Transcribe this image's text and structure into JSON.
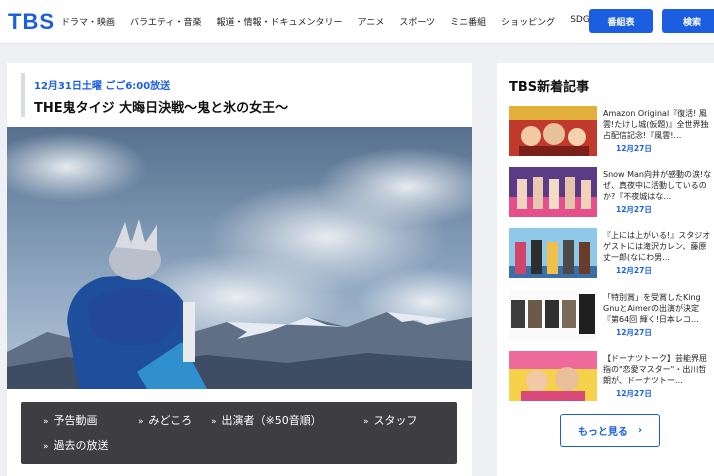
{
  "header": {
    "logo": "TBS",
    "nav": [
      "ドラマ・映画",
      "バラエティ・音楽",
      "報道・情報・ドキュメンタリー",
      "アニメ",
      "スポーツ",
      "ミニ番組",
      "ショッピング",
      "SDGs"
    ],
    "bangumi_label": "番組表",
    "search_label": "検索"
  },
  "program": {
    "date": "12月31日土曜 ごご6:00放送",
    "title": "THE鬼タイジ 大晦日決戦〜鬼と氷の女王〜"
  },
  "program_menu": {
    "items": [
      "予告動画",
      "みどころ",
      "出演者（※50音順）",
      "スタッフ",
      "過去の放送"
    ]
  },
  "sidebar": {
    "title": "TBS新着記事",
    "articles": [
      {
        "text": "Amazon Original『復活! 風雲!たけし城(仮題)』全世界独占配信記念!『風雲!…",
        "date": "12月27日"
      },
      {
        "text": "Snow Man向井が感動の涙!なぜ、真夜中に活動しているのか?『不夜城はな…",
        "date": "12月27日"
      },
      {
        "text": "『上には上がいる!』スタジオゲストには滝沢カレン、藤原丈一郎(なにわ男…",
        "date": "12月27日"
      },
      {
        "text": "「特別賞」を受賞したKing GnuとAimerの出演が決定『第64回 輝く!日本レコ…",
        "date": "12月27日"
      },
      {
        "text": "【ドーナツトーク】芸能界屈指の\"恋愛マスター\"・出川哲朗が、ドーナツトー…",
        "date": "12月27日"
      }
    ],
    "more_label": "もっと見る"
  },
  "colors": {
    "accent": "#1b5fe0",
    "menu_bg": "#3d3d42",
    "page_bg": "#eef0f3"
  },
  "icons": {
    "menu_arrow": "double-chevron-right-icon",
    "more_arrow": "chevron-right-icon"
  }
}
